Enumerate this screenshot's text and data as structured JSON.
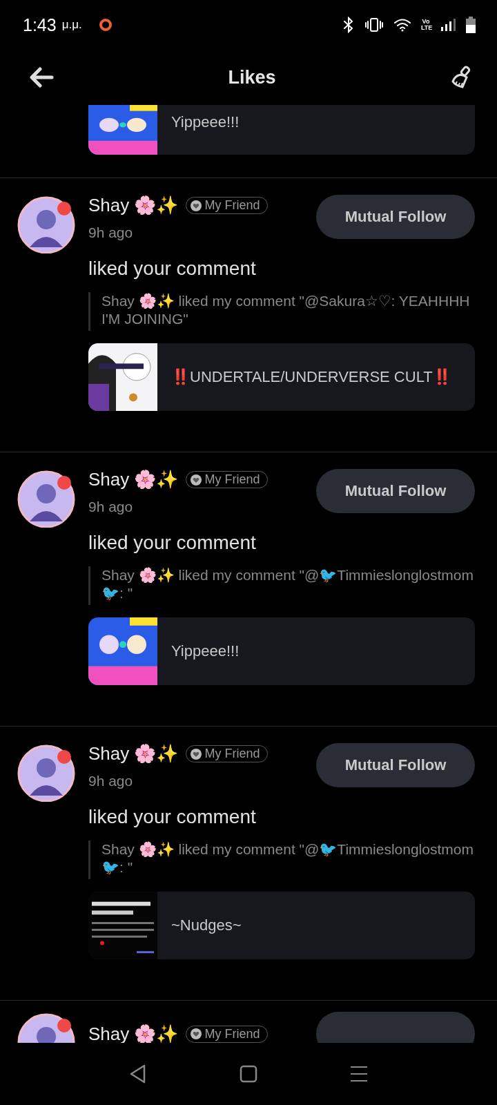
{
  "status_bar": {
    "time": "1:43",
    "time_suffix": "μ.μ.",
    "network": "Vo LTE"
  },
  "header": {
    "title": "Likes"
  },
  "top_card": {
    "text": "Yippeee!!!"
  },
  "items": [
    {
      "name": "Shay 🌸✨",
      "badge": "My Friend",
      "time": "9h ago",
      "button": "Mutual Follow",
      "action": "liked your comment",
      "quote": "Shay 🌸✨ liked my comment \"@Sakura☆♡: YEAHHHH I'M JOINING\"",
      "card_text": "‼️UNDERTALE/UNDERVERSE CULT‼️"
    },
    {
      "name": "Shay 🌸✨",
      "badge": "My Friend",
      "time": "9h ago",
      "button": "Mutual Follow",
      "action": "liked your comment",
      "quote": "Shay 🌸✨ liked my comment \"@🐦Timmieslonglostmom🐦:  \"",
      "card_text": "Yippeee!!!"
    },
    {
      "name": "Shay 🌸✨",
      "badge": "My Friend",
      "time": "9h ago",
      "button": "Mutual Follow",
      "action": "liked your comment",
      "quote": "Shay 🌸✨ liked my comment \"@🐦Timmieslonglostmom🐦: \"",
      "card_text": "~Nudges~"
    }
  ],
  "partial_item": {
    "name": "Shay 🌸✨",
    "badge": "My Friend"
  }
}
